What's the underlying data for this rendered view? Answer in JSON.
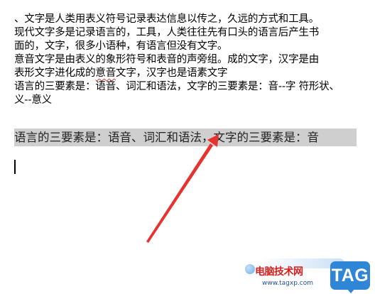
{
  "document": {
    "paragraphs": [
      "、文字是人类用表义符号记录表达信息以传之，久远的方式和工具。",
      "现代文字多是记录语言的，工具，人类往往先有口头的语言后产生书",
      "面的，文字，很多小语种，有语言但没有文字。",
      "意音文字是由表义的象形符号和表音的声旁组。成的文字，汉字是由",
      {
        "before": "表形文字进化成的",
        "squiggle": "意音",
        "after": "文字，汉字也是语素文字"
      },
      "语言的三要素是：语音、词汇和语法，文字的三要素是：音--字  符形状、",
      "义--意义"
    ],
    "selected_line": "语言的三要素是：语音、词汇和语法，文字的三要素是：音"
  },
  "annotation": {
    "arrow_color": "#e8322e",
    "type": "red-arrow"
  },
  "watermark": {
    "site_name_cn": "电脑技术网",
    "url": "www.tagxp.com",
    "badge": "TAG",
    "badge_color": "#2f86d6",
    "text_color": "#d81e1e"
  }
}
